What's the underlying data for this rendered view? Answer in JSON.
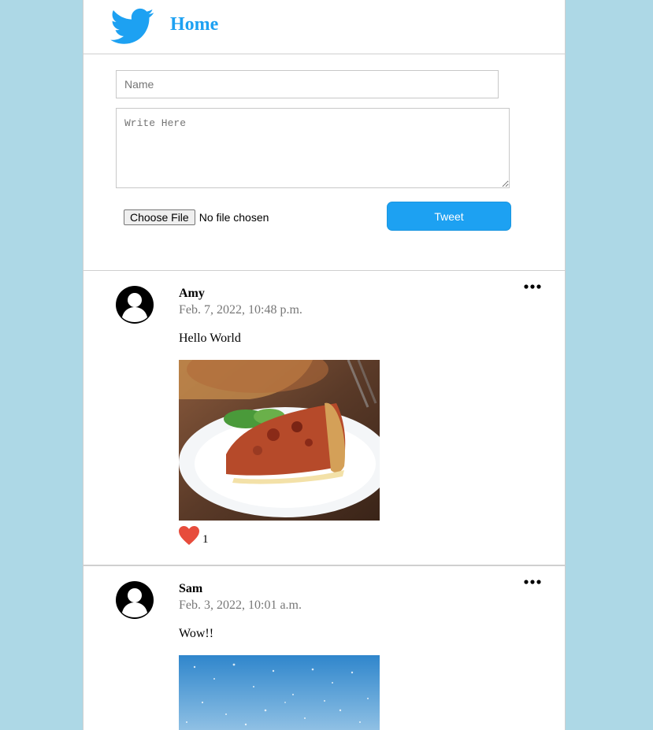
{
  "header": {
    "title": "Home",
    "logo_icon": "twitter-bird-icon",
    "brand_color": "#1da1f2"
  },
  "composer": {
    "name_placeholder": "Name",
    "text_placeholder": "Write Here",
    "file_button_label": "Choose File",
    "file_status": "No file chosen",
    "tweet_button_label": "Tweet"
  },
  "posts": [
    {
      "author": "Amy",
      "date": "Feb. 7, 2022, 10:48 p.m.",
      "text": "Hello World",
      "likes": "1",
      "image_icon": "pizza-photo",
      "avatar_icon": "user-avatar-icon",
      "menu_icon": "more-options-icon"
    },
    {
      "author": "Sam",
      "date": "Feb. 3, 2022, 10:01 a.m.",
      "text": "Wow!!",
      "image_icon": "snow-sky-photo",
      "avatar_icon": "user-avatar-icon",
      "menu_icon": "more-options-icon"
    }
  ],
  "colors": {
    "background": "#add8e6",
    "like": "#e74c3c"
  }
}
